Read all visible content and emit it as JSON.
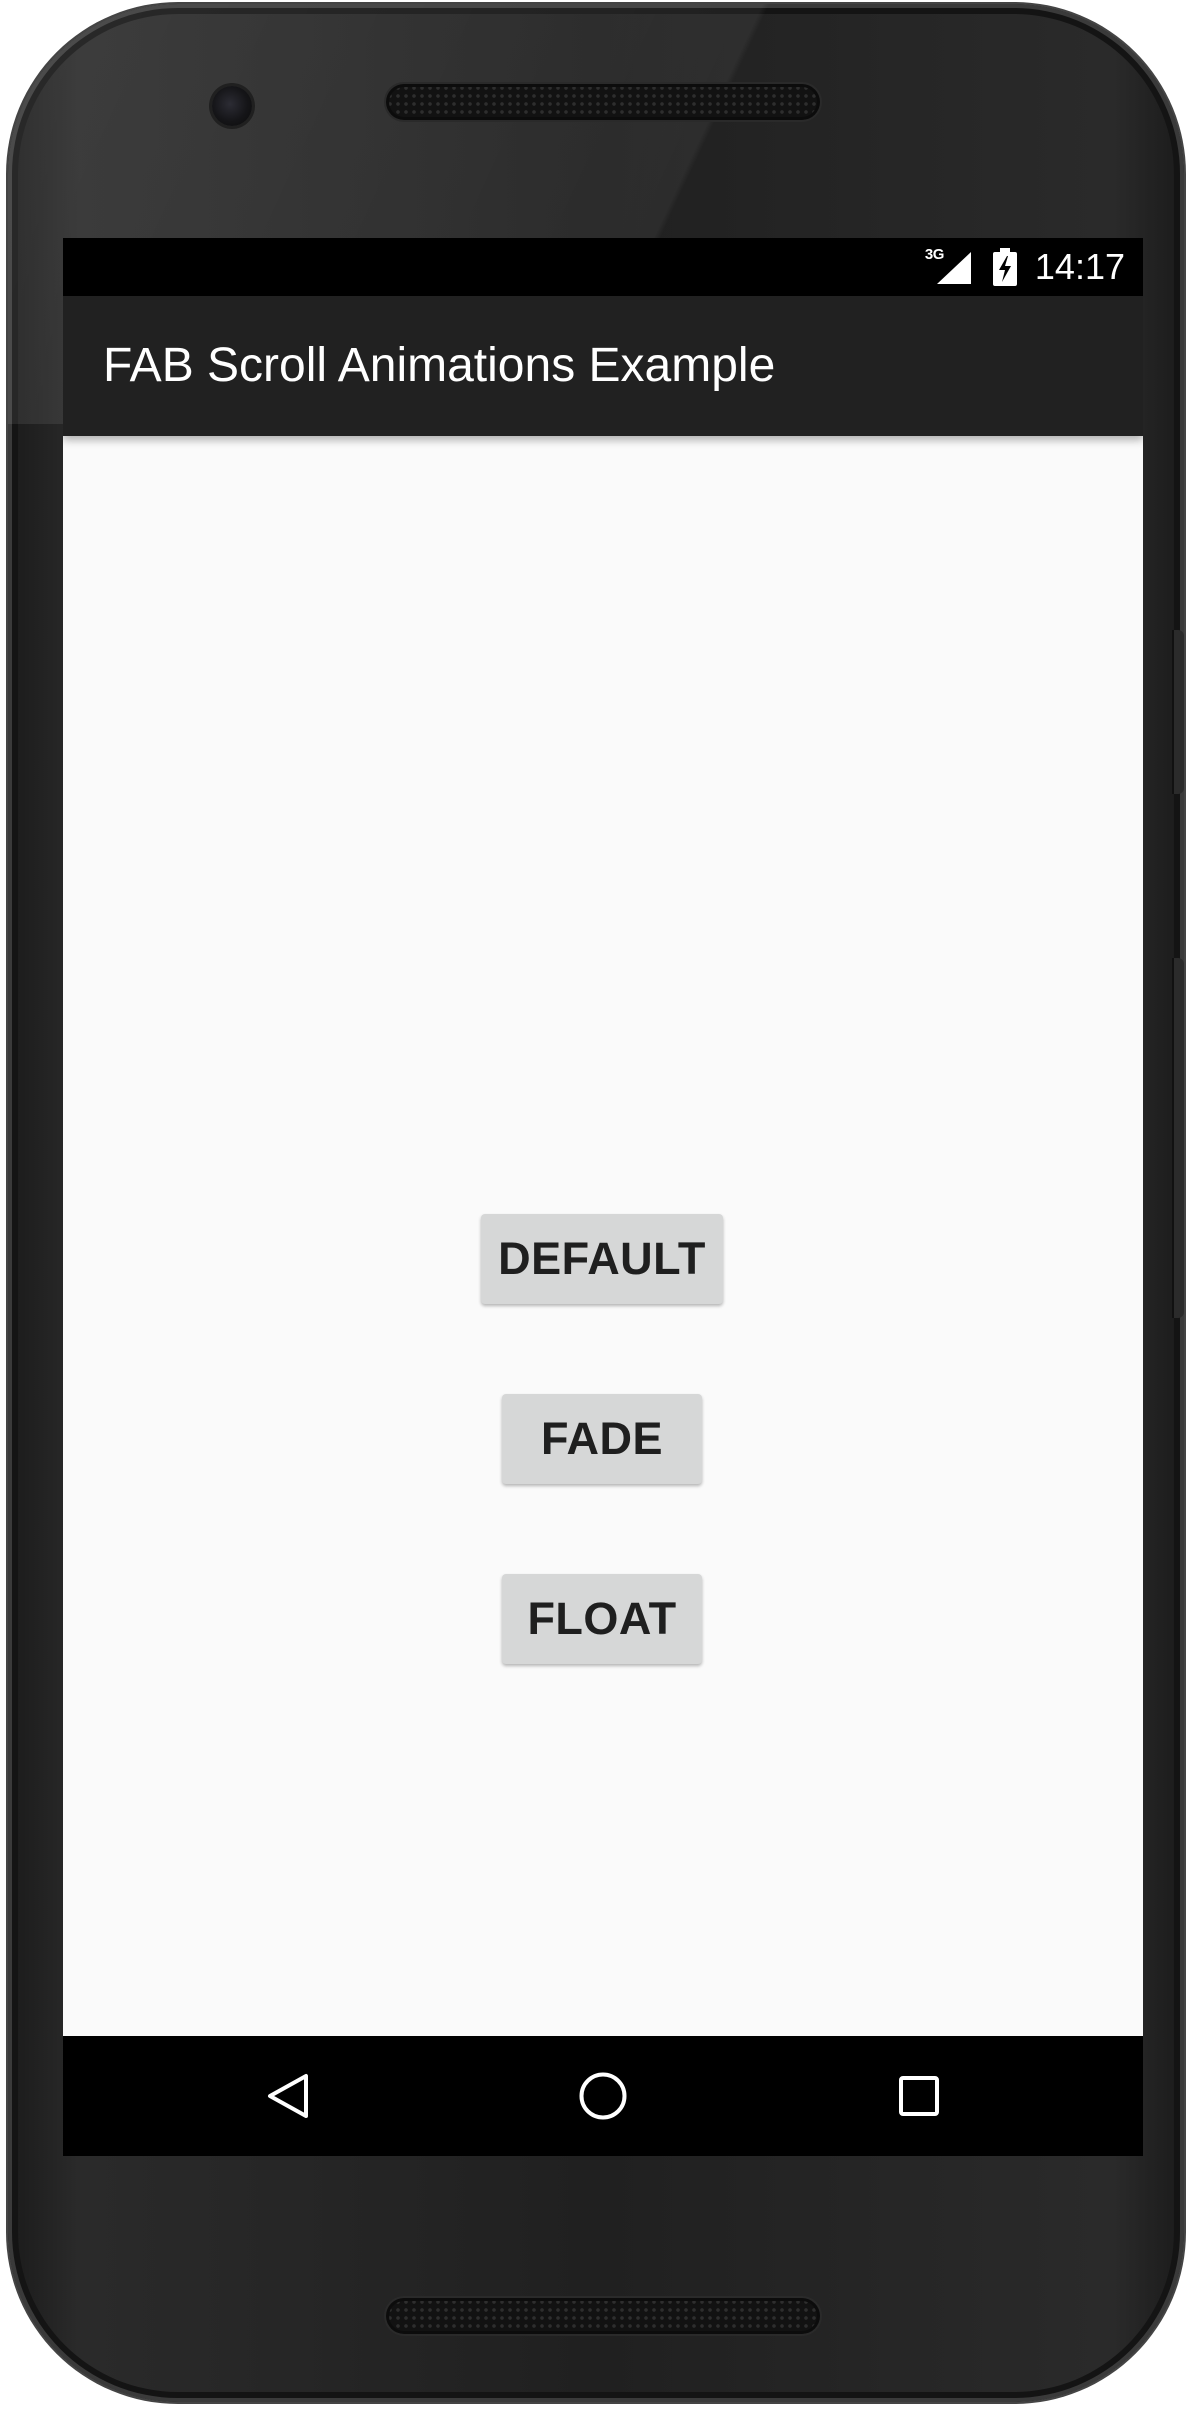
{
  "status_bar": {
    "network_type": "3G",
    "time": "14:17",
    "icons": [
      "signal-icon",
      "battery-charging-icon"
    ]
  },
  "app_bar": {
    "title": "FAB Scroll Animations Example"
  },
  "buttons": {
    "default_label": "DEFAULT",
    "fade_label": "FADE",
    "float_label": "FLOAT"
  },
  "nav_bar": {
    "icons": [
      "back-icon",
      "home-icon",
      "recents-icon"
    ]
  },
  "colors": {
    "app_bar": "#212121",
    "status_bar": "#000000",
    "background": "#fafafa",
    "button": "#d6d7d7",
    "button_text": "#1f1f1f",
    "nav_bar": "#000000"
  }
}
